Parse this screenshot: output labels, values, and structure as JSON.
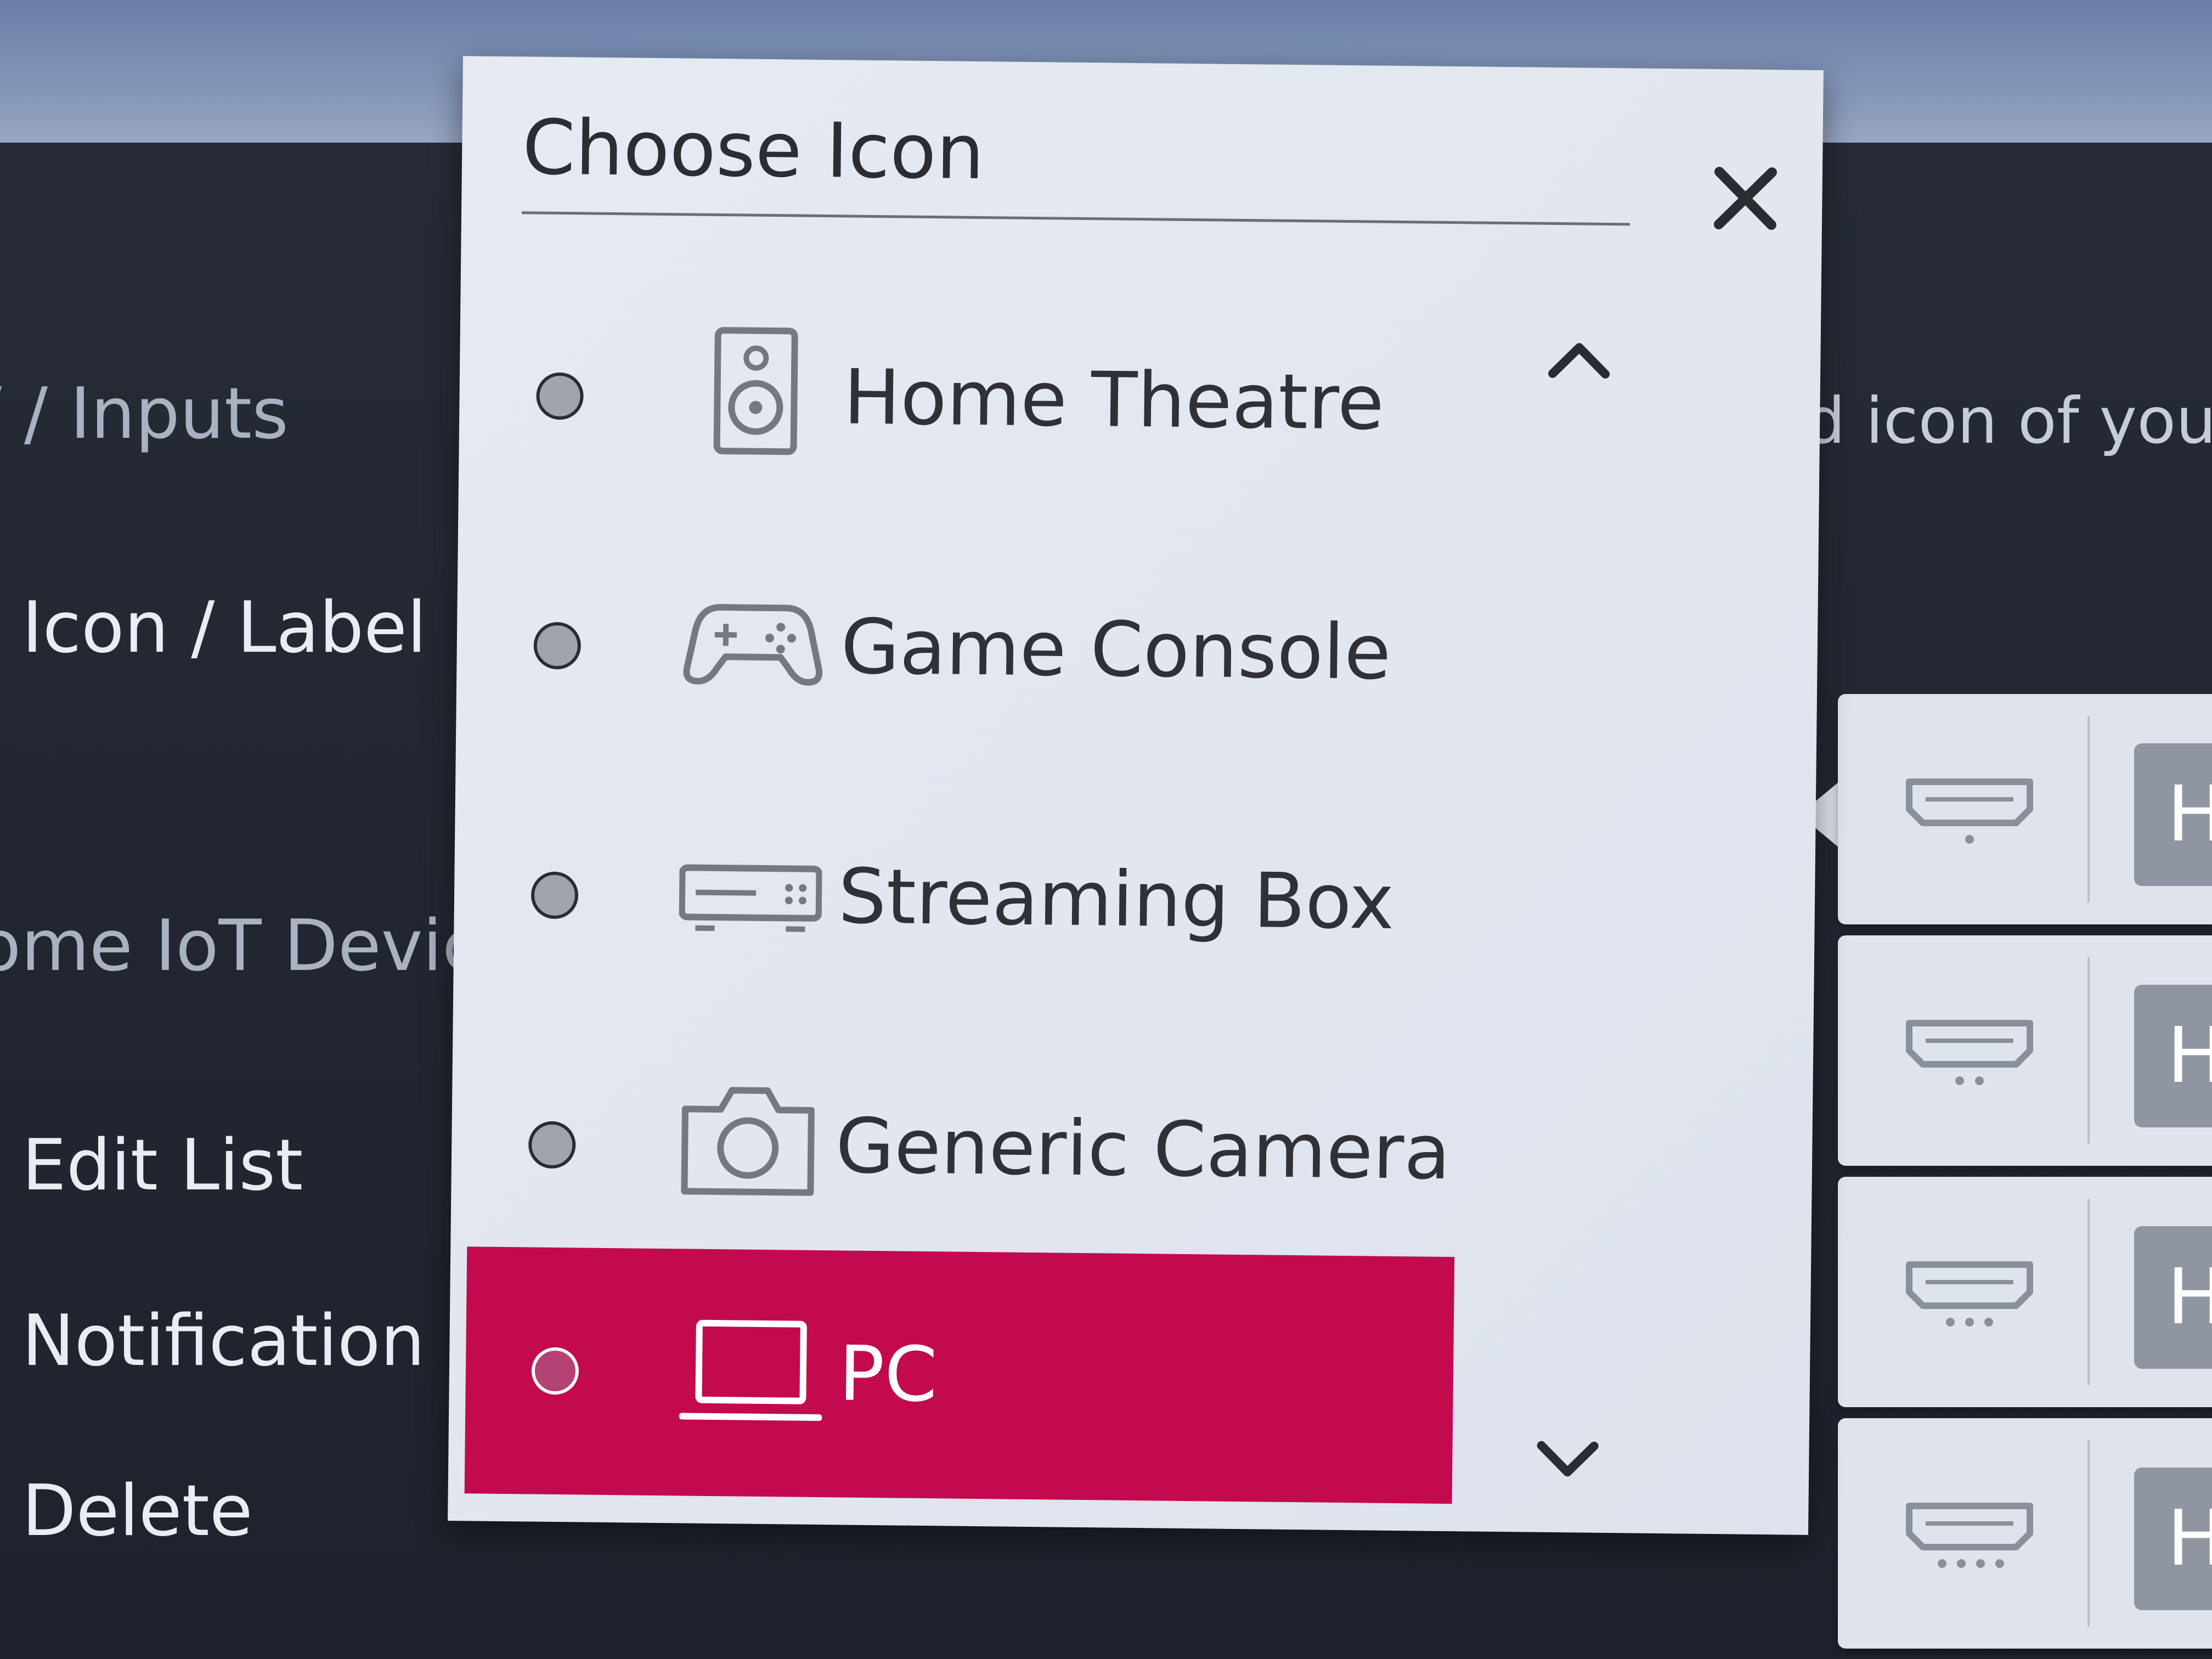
{
  "sidebar": {
    "inputs": "/ / Inputs",
    "icon_label": "Icon / Label",
    "iot": "ome IoT Devic",
    "edit_list": "Edit List",
    "notification": "Notification",
    "delete": "Delete"
  },
  "background": {
    "description_fragment": "d icon of your",
    "device_tag_letter": "H"
  },
  "dialog": {
    "title": "Choose Icon",
    "options": [
      {
        "label": "Home Theatre",
        "icon": "speaker-icon",
        "selected": false
      },
      {
        "label": "Game Console",
        "icon": "gamepad-icon",
        "selected": false
      },
      {
        "label": "Streaming Box",
        "icon": "streaming-box-icon",
        "selected": false
      },
      {
        "label": "Generic Camera",
        "icon": "camera-icon",
        "selected": false
      },
      {
        "label": "PC",
        "icon": "laptop-icon",
        "selected": true
      }
    ]
  },
  "colors": {
    "accent": "#c30a4e",
    "dialog_bg": "#e3e7ef",
    "background": "#1f2430"
  }
}
